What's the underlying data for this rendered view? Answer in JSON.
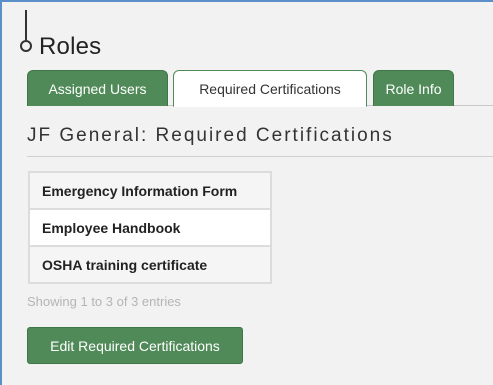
{
  "page": {
    "title": "Roles"
  },
  "tabs": [
    {
      "label": "Assigned Users",
      "active": false
    },
    {
      "label": "Required Certifications",
      "active": true
    },
    {
      "label": "Role Info",
      "active": false
    }
  ],
  "section": {
    "title": "JF General: Required Certifications"
  },
  "certifications": [
    "Emergency Information Form",
    "Employee Handbook",
    "OSHA training certificate"
  ],
  "table_info": "Showing 1 to 3 of 3 entries",
  "edit_button_label": "Edit Required Certifications",
  "colors": {
    "accent_green": "#4f8a58",
    "frame_blue": "#5b8fc7",
    "background": "#f2f2f2"
  },
  "icons": {
    "timeline": "timeline-node-icon"
  }
}
